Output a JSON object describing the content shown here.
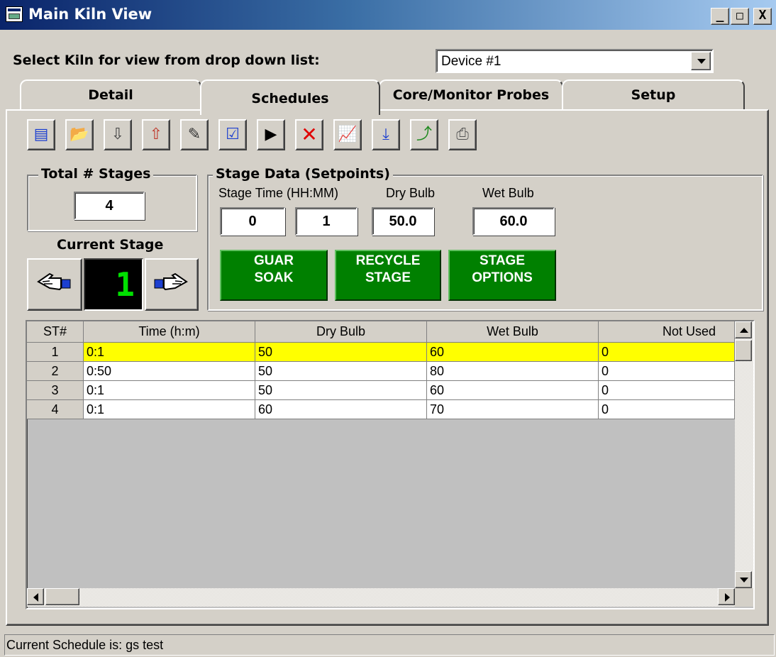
{
  "window": {
    "title": "Main Kiln View",
    "controls": {
      "minimize": "_",
      "maximize": "□",
      "close": "X"
    }
  },
  "selector": {
    "label": "Select Kiln for view from drop down list:",
    "value": "Device #1"
  },
  "tabs": [
    {
      "label": "Detail",
      "active": false
    },
    {
      "label": "Schedules",
      "active": true
    },
    {
      "label": "Core/Monitor Probes",
      "active": false
    },
    {
      "label": "Setup",
      "active": false
    }
  ],
  "toolbar": {
    "buttons": [
      {
        "icon": "new-schedule-icon",
        "glyph": "▤"
      },
      {
        "icon": "open-folder-icon",
        "glyph": "📂"
      },
      {
        "icon": "save-to-kiln-icon",
        "glyph": "⇩"
      },
      {
        "icon": "load-from-kiln-icon",
        "glyph": "⇧"
      },
      {
        "icon": "edit-icon",
        "glyph": "✎"
      },
      {
        "icon": "properties-icon",
        "glyph": "☑"
      },
      {
        "icon": "play-icon",
        "glyph": "▶"
      },
      {
        "icon": "delete-icon",
        "glyph": "✕"
      },
      {
        "icon": "chart-icon",
        "glyph": "📈"
      },
      {
        "icon": "download-icon",
        "glyph": "⤓"
      },
      {
        "icon": "export-icon",
        "glyph": "⤴"
      },
      {
        "icon": "print-icon",
        "glyph": "⎙"
      }
    ]
  },
  "total_stages": {
    "title": "Total # Stages",
    "value": "4"
  },
  "current_stage": {
    "title": "Current Stage",
    "value": "1"
  },
  "stage_data": {
    "title": "Stage Data (Setpoints)",
    "time_label": "Stage Time (HH:MM)",
    "dry_label": "Dry Bulb",
    "wet_label": "Wet Bulb",
    "hours": "0",
    "minutes": "1",
    "dry_bulb": "50.0",
    "wet_bulb": "60.0"
  },
  "action_buttons": {
    "guar_soak": [
      "GUAR",
      "SOAK"
    ],
    "recycle": [
      "RECYCLE",
      "STAGE"
    ],
    "options": [
      "STAGE",
      "OPTIONS"
    ]
  },
  "colors": {
    "green_button": "#008000",
    "highlight_row": "#ffff00",
    "title_bar": "#0a246a",
    "window_bg": "#d4d0c8"
  },
  "grid": {
    "headers": [
      "ST#",
      "Time (h:m)",
      "Dry Bulb",
      "Wet Bulb",
      "Not Used"
    ],
    "rows": [
      {
        "st": "1",
        "time": "0:1",
        "dry": "50",
        "wet": "60",
        "notused": "0",
        "highlighted": true
      },
      {
        "st": "2",
        "time": "0:50",
        "dry": "50",
        "wet": "80",
        "notused": "0",
        "highlighted": false
      },
      {
        "st": "3",
        "time": "0:1",
        "dry": "50",
        "wet": "60",
        "notused": "0",
        "highlighted": false
      },
      {
        "st": "4",
        "time": "0:1",
        "dry": "60",
        "wet": "70",
        "notused": "0",
        "highlighted": false
      }
    ]
  },
  "status": {
    "text": "Current Schedule is: gs test"
  }
}
